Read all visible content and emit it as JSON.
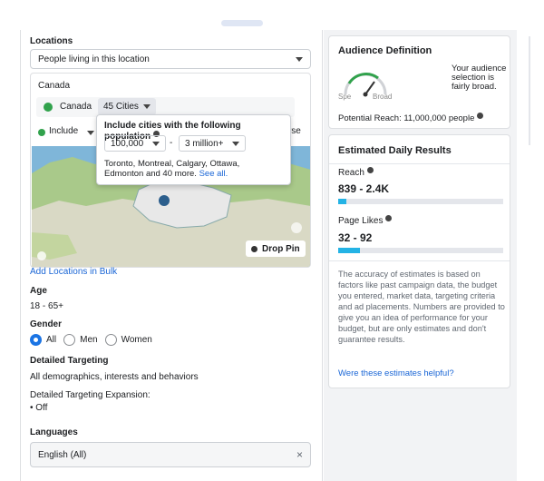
{
  "locations": {
    "heading": "Locations",
    "dropdown_value": "People living in this location",
    "country_group": "Canada",
    "country_chip": "Canada",
    "cities_chip": "45 Cities",
    "include_label": "Include",
    "browse_fragment": "wse",
    "drop_pin": "Drop Pin",
    "add_bulk": "Add Locations in Bulk"
  },
  "popup": {
    "title": "Include cities with the following population",
    "min_value": "100,000",
    "separator": "-",
    "max_value": "3 million+",
    "cities_text": "Toronto, Montreal, Calgary, Ottawa, Edmonton and 40 more.",
    "see_all": "See all."
  },
  "age": {
    "heading": "Age",
    "value": "18 - 65+"
  },
  "gender": {
    "heading": "Gender",
    "options": [
      "All",
      "Men",
      "Women"
    ],
    "selected": "All"
  },
  "detailed_targeting": {
    "heading": "Detailed Targeting",
    "value": "All demographics, interests and behaviors",
    "expansion_label": "Detailed Targeting Expansion:",
    "expansion_value": "Off"
  },
  "languages": {
    "heading": "Languages",
    "value": "English (All)"
  },
  "audience": {
    "title": "Audience Definition",
    "gauge_left": "Spe",
    "gauge_right": "Broad",
    "description": "Your audience selection is fairly broad.",
    "potential_reach": "Potential Reach: 11,000,000 people"
  },
  "estimated": {
    "title": "Estimated Daily Results",
    "reach_label": "Reach",
    "reach_value": "839 - 2.4K",
    "reach_fill": 0.05,
    "likes_label": "Page Likes",
    "likes_value": "32 - 92",
    "likes_fill": 0.13,
    "disclaimer": "The accuracy of estimates is based on factors like past campaign data, the budget you entered, market data, targeting criteria and ad placements. Numbers are provided to give you an idea of performance for your budget, but are only estimates and don't guarantee results.",
    "helpful_link": "Were these estimates helpful?"
  },
  "colors": {
    "accent": "#1b74e4",
    "bar": "#24b3e5",
    "pin_green": "#31a24c",
    "gauge": "#31a24c"
  }
}
